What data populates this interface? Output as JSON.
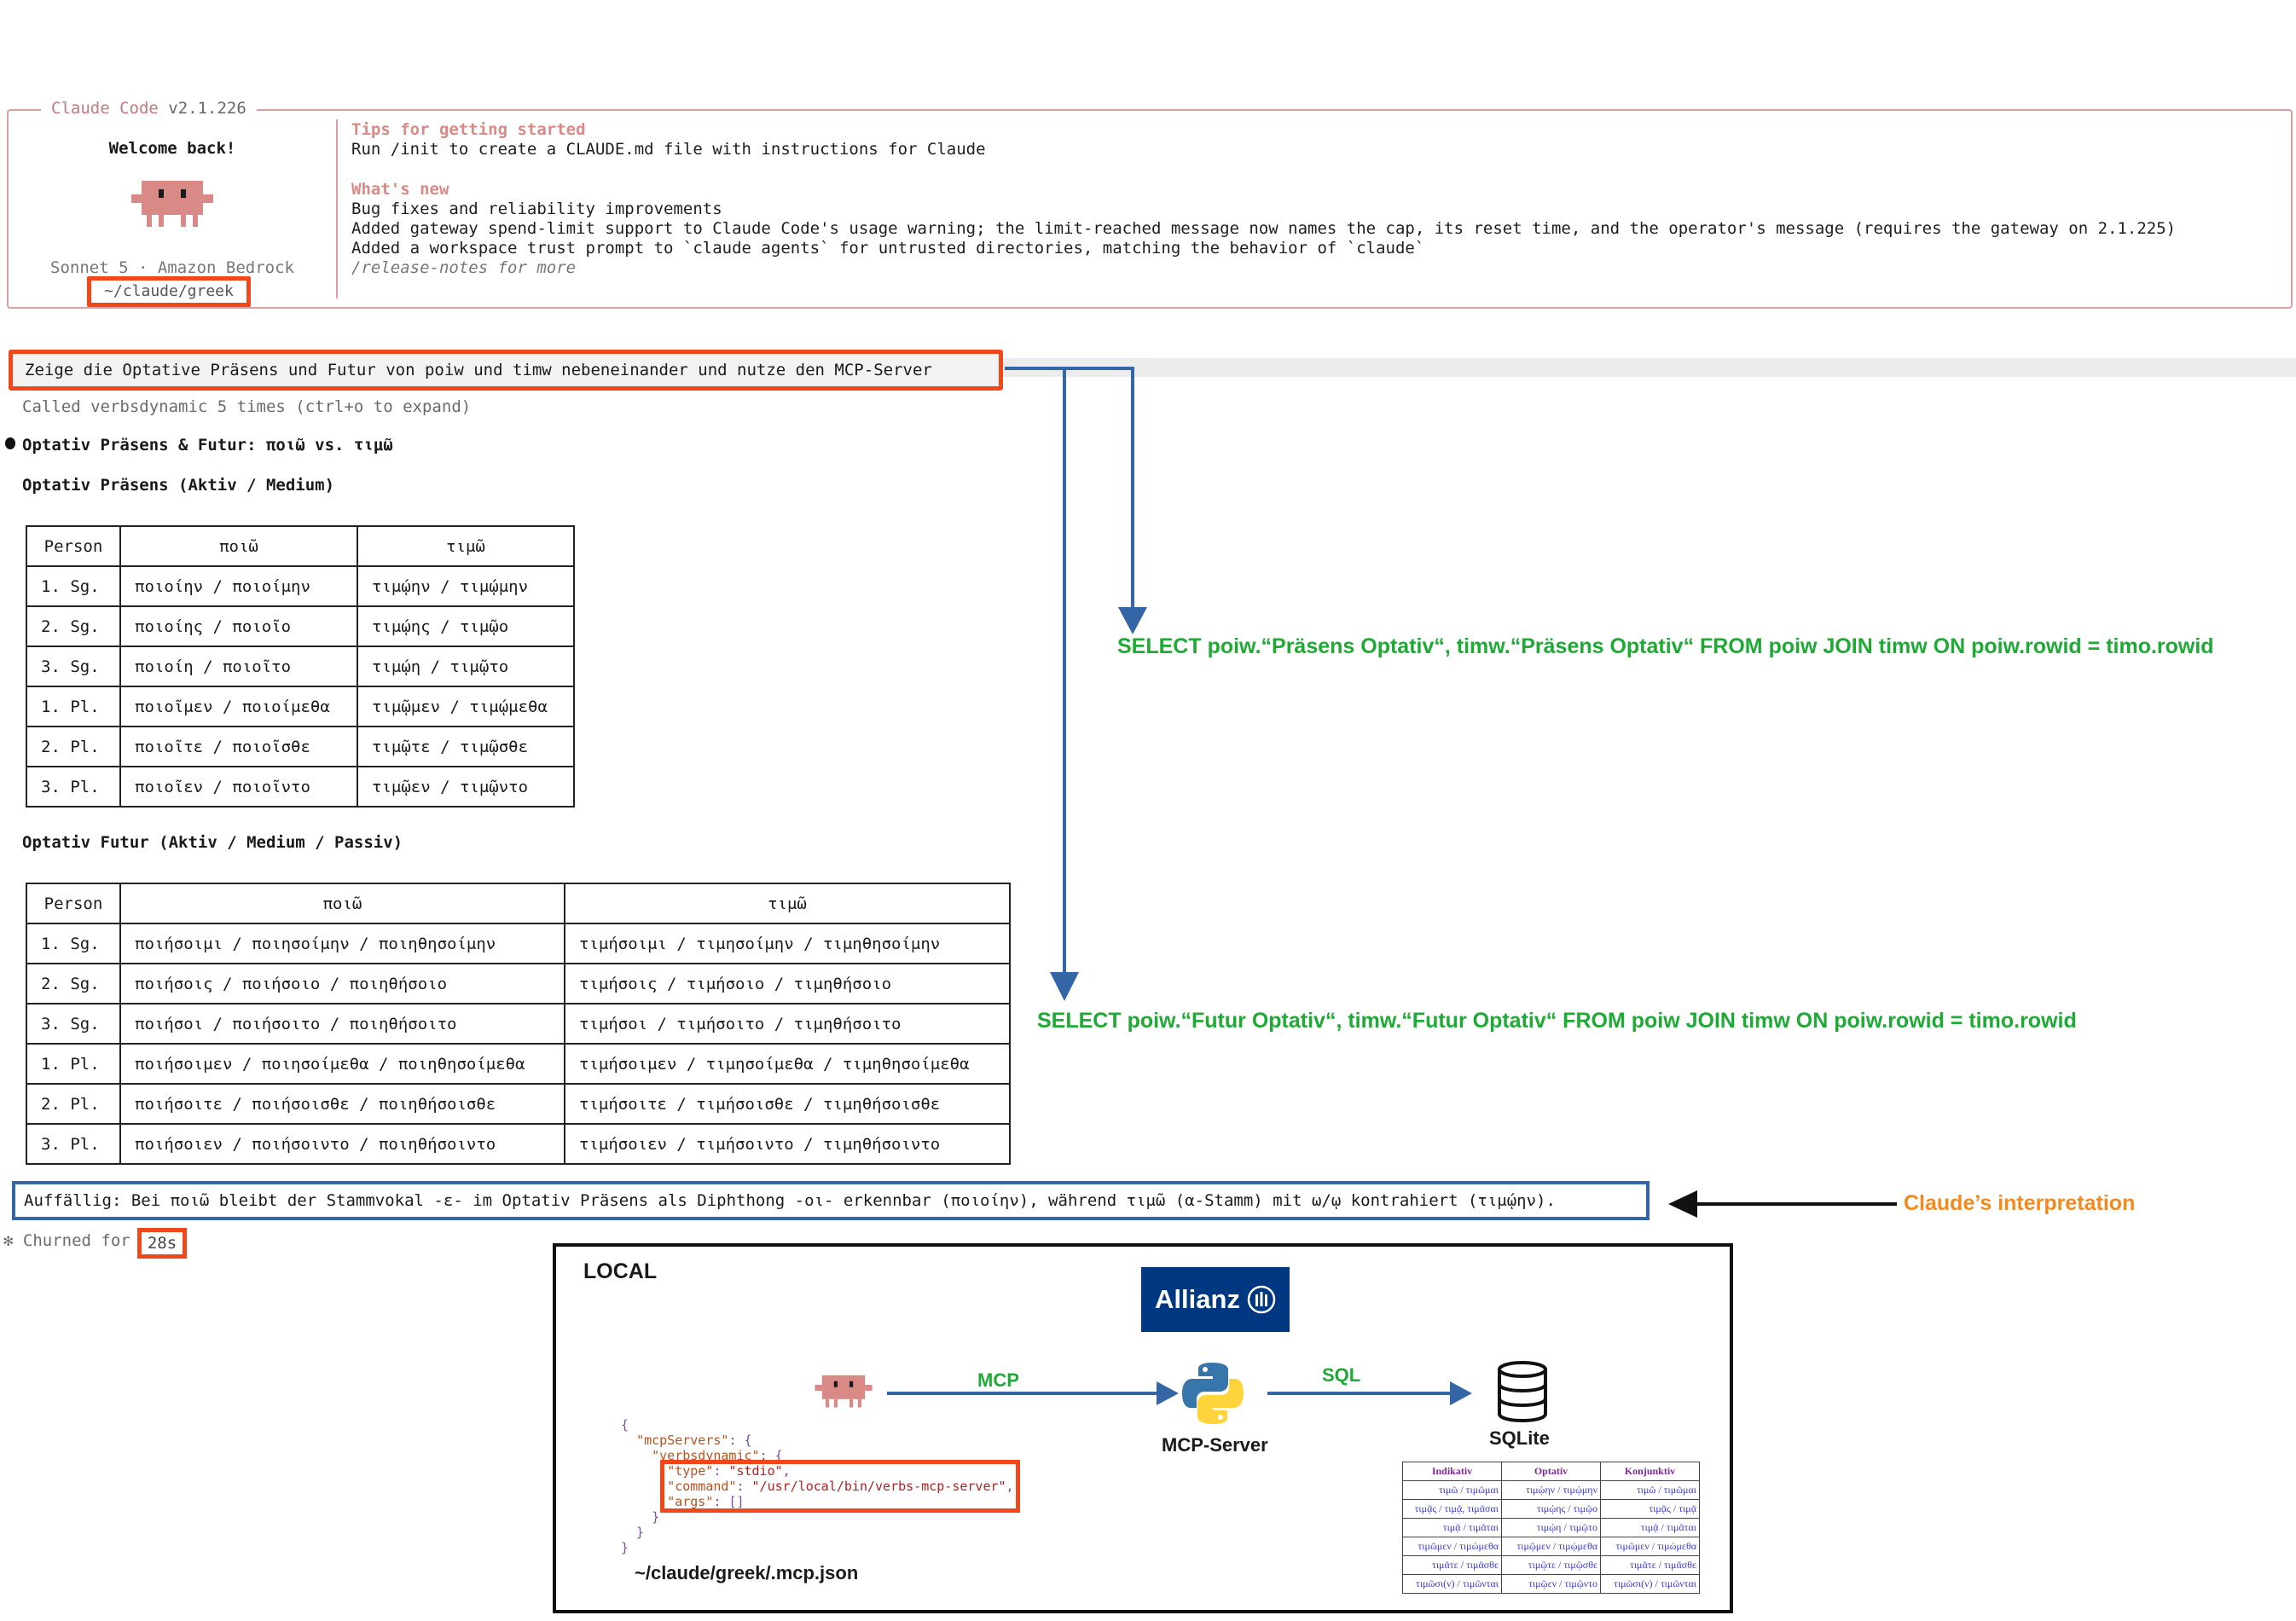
{
  "header": {
    "app_name": "Claude Code",
    "version": "v2.1.226",
    "welcome": "Welcome back!",
    "model": "Sonnet 5 · Amazon Bedrock",
    "cwd": "~/claude/greek"
  },
  "tips": {
    "heading": "Tips for getting started",
    "text": "Run /init to create a CLAUDE.md file with instructions for Claude"
  },
  "whats_new": {
    "heading": "What's new",
    "items": [
      "Bug fixes and reliability improvements",
      "Added gateway spend-limit support to Claude Code's usage warning; the limit-reached message now names the cap, its reset time, and the operator's message (requires the gateway on 2.1.225)",
      "Added a workspace trust prompt to `claude agents` for untrusted directories, matching the behavior of `claude`"
    ],
    "more": "/release-notes for more"
  },
  "conversation": {
    "prompt": "Zeige die Optative Präsens und Futur von poiw und timw nebeneinander und nutze den MCP-Server",
    "tool_calls": "Called verbsdynamic 5 times (ctrl+o to expand)",
    "result_title": "Optativ Präsens & Futur: ποιῶ vs. τιμῶ",
    "section1_title": "Optativ Präsens (Aktiv / Medium)",
    "table1": {
      "headers": [
        "Person",
        "ποιῶ",
        "τιμῶ"
      ],
      "rows": [
        [
          "1. Sg.",
          "ποιοίην / ποιοίμην",
          "τιμῴην / τιμῴμην"
        ],
        [
          "2. Sg.",
          "ποιοίης / ποιοῖο",
          "τιμῴης / τιμῷο"
        ],
        [
          "3. Sg.",
          "ποιοίη / ποιοῖτο",
          "τιμῴη / τιμῷτο"
        ],
        [
          "1. Pl.",
          "ποιοῖμεν / ποιοίμεθα",
          "τιμῷμεν / τιμῴμεθα"
        ],
        [
          "2. Pl.",
          "ποιοῖτε / ποιοῖσθε",
          "τιμῷτε / τιμῷσθε"
        ],
        [
          "3. Pl.",
          "ποιοῖεν / ποιοῖντο",
          "τιμῷεν / τιμῷντο"
        ]
      ]
    },
    "section2_title": "Optativ Futur (Aktiv / Medium / Passiv)",
    "table2": {
      "headers": [
        "Person",
        "ποιῶ",
        "τιμῶ"
      ],
      "rows": [
        [
          "1. Sg.",
          "ποιήσοιμι / ποιησοίμην / ποιηθησοίμην",
          "τιμήσοιμι / τιμησοίμην / τιμηθησοίμην"
        ],
        [
          "2. Sg.",
          "ποιήσοις / ποιήσοιο / ποιηθήσοιο",
          "τιμήσοις / τιμήσοιο / τιμηθήσοιο"
        ],
        [
          "3. Sg.",
          "ποιήσοι / ποιήσοιτο / ποιηθήσοιτο",
          "τιμήσοι / τιμήσοιτο / τιμηθήσοιτο"
        ],
        [
          "1. Pl.",
          "ποιήσοιμεν / ποιησοίμεθα / ποιηθησοίμεθα",
          "τιμήσοιμεν / τιμησοίμεθα / τιμηθησοίμεθα"
        ],
        [
          "2. Pl.",
          "ποιήσοιτε / ποιήσοισθε / ποιηθήσοισθε",
          "τιμήσοιτε / τιμήσοισθε / τιμηθήσοισθε"
        ],
        [
          "3. Pl.",
          "ποιήσοιεν / ποιήσοιντο / ποιηθήσοιντο",
          "τιμήσοιεν / τιμήσοιντο / τιμηθήσοιντο"
        ]
      ]
    },
    "note": "Auffällig: Bei ποιῶ bleibt der Stammvokal -ε- im Optativ Präsens als Diphthong -οι- erkennbar (ποιοίην), während τιμῶ (α-Stamm) mit ω/ῳ kontrahiert (τιμῴην).",
    "churn_prefix": "✻ Churned for",
    "churn_time": "28s"
  },
  "annotations": {
    "sql1": "SELECT poiw.“Präsens Optativ“, timw.“Präsens Optativ“ FROM poiw JOIN timw ON poiw.rowid = timo.rowid",
    "sql2": "SELECT poiw.“Futur Optativ“, timw.“Futur Optativ“ FROM poiw JOIN timw ON poiw.rowid = timo.rowid",
    "interpretation": "Claude’s interpretation"
  },
  "diagram": {
    "title": "LOCAL",
    "brand": "Allianz",
    "mcp_label": "MCP",
    "sql_label": "SQL",
    "server_label": "MCP-Server",
    "db_label": "SQLite",
    "config_path": "~/claude/greek/.mcp.json",
    "json_lines": {
      "l1": "{",
      "l2_key": "\"mcpServers\"",
      "l3_key": "\"verbsdynamic\"",
      "type_key": "\"type\"",
      "type_val": "\"stdio\"",
      "cmd_key": "\"command\"",
      "cmd_val": "\"/usr/local/bin/verbs-mcp-server\"",
      "args_key": "\"args\"",
      "args_val": "[]"
    },
    "mini_table": {
      "headers": [
        "Indikativ",
        "Optativ",
        "Konjunktiv"
      ],
      "rows": [
        [
          "τιμῶ / τιμῶμαι",
          "τιμῴην / τιμῴμην",
          "τιμῶ / τιμῶμαι"
        ],
        [
          "τιμᾷς / τιμᾷ, τιμᾶσαι",
          "τιμῴης / τιμῷο",
          "τιμᾷς / τιμᾷ"
        ],
        [
          "τιμᾷ / τιμᾶται",
          "τιμῴη / τιμῷτο",
          "τιμᾷ / τιμᾶται"
        ],
        [
          "τιμῶμεν / τιμώμεθα",
          "τιμῷμεν / τιμῴμεθα",
          "τιμῶμεν / τιμώμεθα"
        ],
        [
          "τιμᾶτε / τιμᾶσθε",
          "τιμῷτε / τιμῷσθε",
          "τιμᾶτε / τιμᾶσθε"
        ],
        [
          "τιμῶσι(ν) / τιμῶνται",
          "τιμῷεν / τιμῷντο",
          "τιμῶσι(ν) / τιμῶνται"
        ]
      ]
    }
  },
  "colors": {
    "highlight_red": "#f0481b",
    "note_blue": "#3466a6",
    "sql_green": "#1eaa35",
    "interp_orange": "#f28a1f",
    "allianz_blue": "#003781",
    "brand_salmon": "#d9a0a2"
  }
}
